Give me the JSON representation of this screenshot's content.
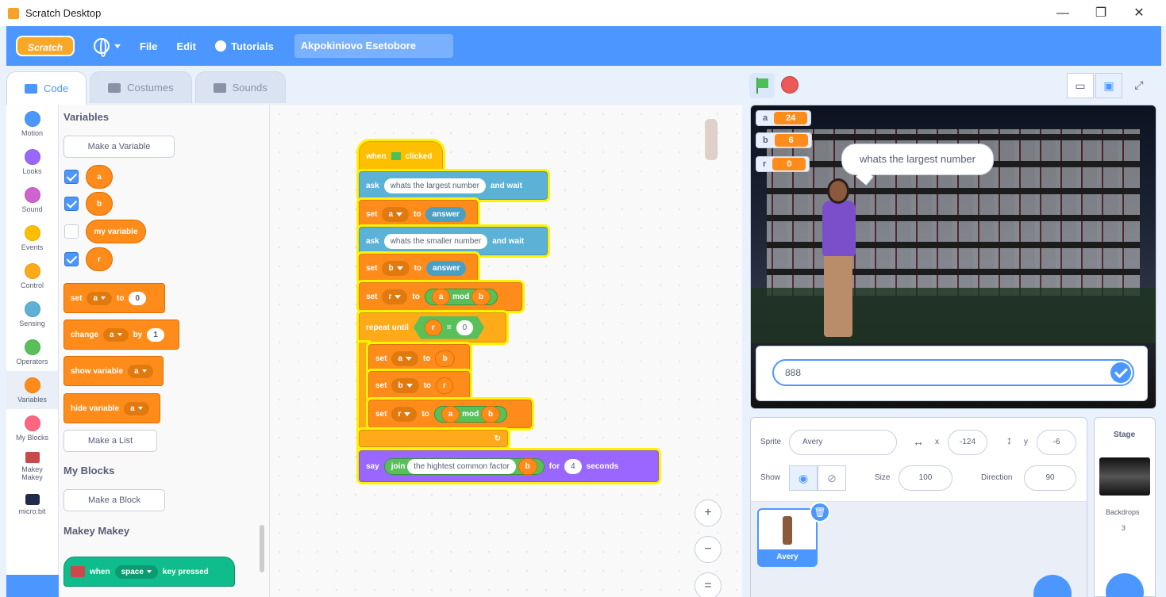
{
  "window": {
    "title": "Scratch Desktop",
    "controls": [
      "—",
      "❐",
      "✕"
    ]
  },
  "menubar": {
    "logo": "Scratch",
    "file": "File",
    "edit": "Edit",
    "tutorials": "Tutorials",
    "project_title": "Akpokiniovo Esetobore"
  },
  "tabs": {
    "code": "Code",
    "costumes": "Costumes",
    "sounds": "Sounds"
  },
  "categories": [
    {
      "label": "Motion",
      "color": "#4c97ff"
    },
    {
      "label": "Looks",
      "color": "#9966ff"
    },
    {
      "label": "Sound",
      "color": "#cf63cf"
    },
    {
      "label": "Events",
      "color": "#ffbf00"
    },
    {
      "label": "Control",
      "color": "#ffab19"
    },
    {
      "label": "Sensing",
      "color": "#5cb1d6"
    },
    {
      "label": "Operators",
      "color": "#59c059"
    },
    {
      "label": "Variables",
      "color": "#ff8c1a"
    },
    {
      "label": "My Blocks",
      "color": "#ff6680"
    }
  ],
  "extensions": {
    "makey": "Makey Makey",
    "microbit": "micro:bit"
  },
  "palette": {
    "variables_heading": "Variables",
    "make_variable": "Make a Variable",
    "vars": [
      "a",
      "b",
      "my variable",
      "r"
    ],
    "set": "set",
    "to": "to",
    "set_var": "a",
    "set_val": "0",
    "change": "change",
    "by": "by",
    "change_var": "a",
    "change_val": "1",
    "show_variable": "show variable",
    "show_var": "a",
    "hide_variable": "hide variable",
    "hide_var": "a",
    "make_list": "Make a List",
    "myblocks_heading": "My Blocks",
    "make_block": "Make a Block",
    "makey_heading": "Makey Makey",
    "when": "when",
    "key": "space",
    "key_pressed": "key pressed"
  },
  "script": {
    "when": "when",
    "clicked": "clicked",
    "ask": "ask",
    "and_wait": "and wait",
    "q1": "whats the largest  number",
    "q2": "whats the smaller number",
    "set": "set",
    "to": "to",
    "var_a": "a",
    "var_b": "b",
    "var_r": "r",
    "answer": "answer",
    "mod": "mod",
    "repeat_until": "repeat until",
    "equals": "=",
    "zero": "0",
    "say": "say",
    "join": "join",
    "hcf": "the hightest common factor",
    "for": "for",
    "secs_val": "4",
    "seconds": "seconds"
  },
  "zoom": {
    "in": "+",
    "out": "−",
    "reset": "="
  },
  "stage": {
    "monitors": [
      {
        "name": "a",
        "value": "24"
      },
      {
        "name": "b",
        "value": "6"
      },
      {
        "name": "r",
        "value": "0"
      }
    ],
    "bubble": "whats the largest  number",
    "answer_value": "888"
  },
  "sprite_info": {
    "sprite_label": "Sprite",
    "sprite_name": "Avery",
    "x_label": "x",
    "x": "-124",
    "y_label": "y",
    "y": "-6",
    "show_label": "Show",
    "size_label": "Size",
    "size": "100",
    "direction_label": "Direction",
    "direction": "90",
    "sprite_thumb_name": "Avery"
  },
  "stage_pane": {
    "title": "Stage",
    "backdrops_label": "Backdrops",
    "backdrops_count": "3"
  }
}
